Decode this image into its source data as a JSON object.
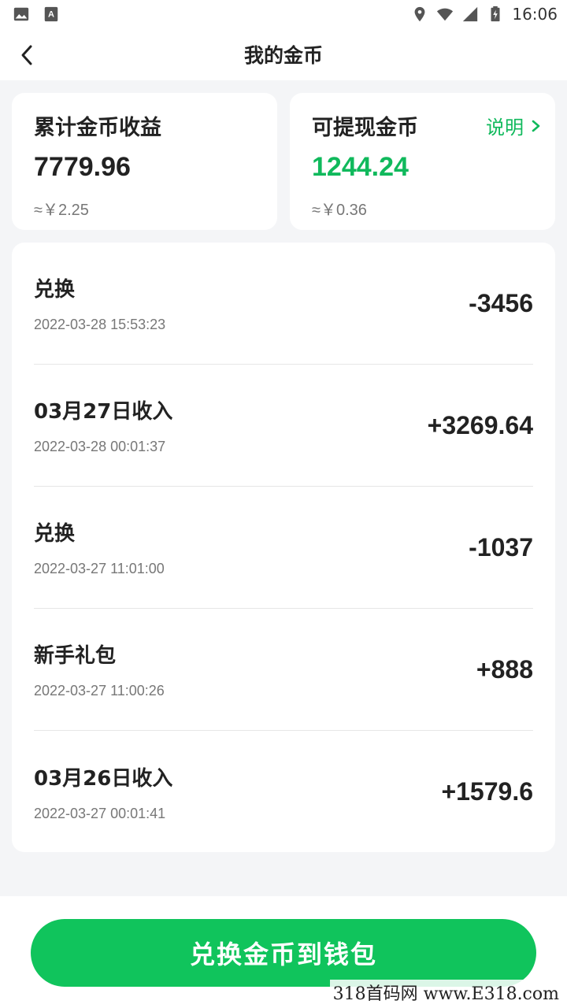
{
  "status_bar": {
    "time": "16:06"
  },
  "nav": {
    "title": "我的金币"
  },
  "summary": {
    "total": {
      "label": "累计金币收益",
      "value": "7779.96",
      "approx": "≈￥2.25"
    },
    "withdrawable": {
      "label": "可提现金币",
      "value": "1244.24",
      "approx": "≈￥0.36",
      "explain_label": "说明"
    }
  },
  "records": [
    {
      "title": "兑换",
      "time": "2022-03-28 15:53:23",
      "amount": "-3456"
    },
    {
      "title": "03月27日收入",
      "time": "2022-03-28 00:01:37",
      "amount": "+3269.64"
    },
    {
      "title": "兑换",
      "time": "2022-03-27 11:01:00",
      "amount": "-1037"
    },
    {
      "title": "新手礼包",
      "time": "2022-03-27 11:00:26",
      "amount": "+888"
    },
    {
      "title": "03月26日收入",
      "time": "2022-03-27 00:01:41",
      "amount": "+1579.6"
    }
  ],
  "cta": {
    "label": "兑换金币到钱包"
  },
  "watermark": "318首码网  www.E318.com",
  "colors": {
    "accent": "#10c45c",
    "accent_text": "#10b95c"
  }
}
